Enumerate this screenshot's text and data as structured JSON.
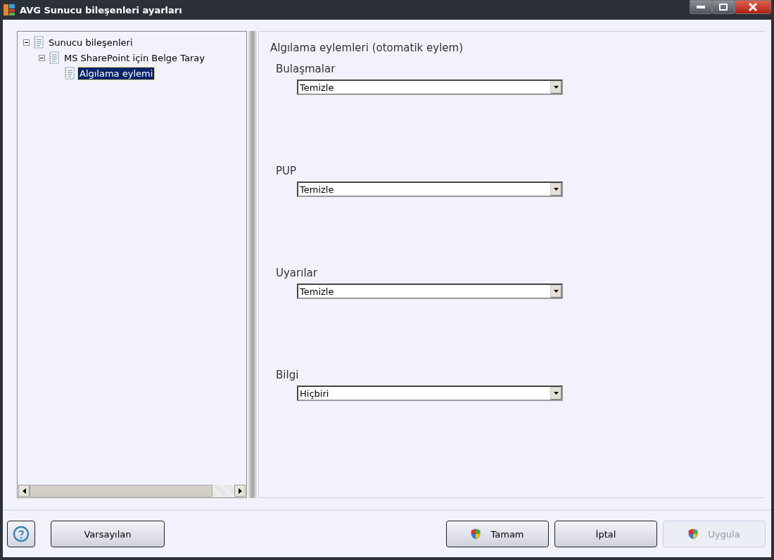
{
  "window": {
    "title": "AVG Sunucu bileşenleri ayarları"
  },
  "tree": [
    {
      "label": "Sunucu bileşenleri",
      "expanded": true,
      "selected": false,
      "children": [
        {
          "label": "MS SharePoint için Belge Taray",
          "expanded": true,
          "selected": false,
          "children": [
            {
              "label": "Algılama eylemi",
              "selected": true
            }
          ]
        }
      ]
    }
  ],
  "panel": {
    "heading": "Algılama eylemleri (otomatik eylem)",
    "fields": [
      {
        "label": "Bulaşmalar",
        "value": "Temizle"
      },
      {
        "label": "PUP",
        "value": "Temizle"
      },
      {
        "label": "Uyarılar",
        "value": "Temizle"
      },
      {
        "label": "Bilgi",
        "value": "Hiçbiri"
      }
    ]
  },
  "defaults_button": {
    "label": "Varsayılan"
  },
  "buttons": [
    {
      "label": "Tamam",
      "kind": "shield",
      "disabled": false
    },
    {
      "label": "İptal",
      "kind": "plain",
      "disabled": false
    },
    {
      "label": "Uygula",
      "kind": "shield",
      "disabled": true
    }
  ]
}
